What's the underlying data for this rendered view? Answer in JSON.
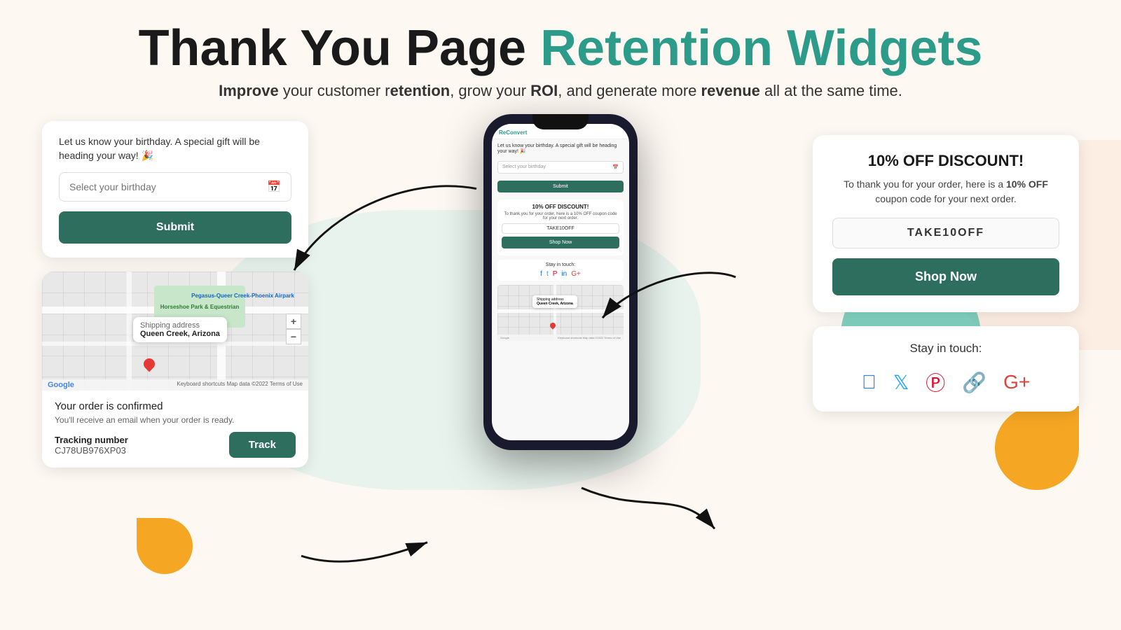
{
  "page": {
    "background": "#fdf8f2"
  },
  "header": {
    "title_black": "Thank You Page",
    "title_teal": "Retention Widgets",
    "subtitle_pre": "Improve",
    "subtitle_mid1": " your customer r",
    "subtitle_mid2": "etention",
    "subtitle_mid3": ", grow your ",
    "subtitle_roi": "ROI",
    "subtitle_mid4": ", and generate more ",
    "subtitle_revenue": "revenue",
    "subtitle_end": " all at the same time."
  },
  "birthday_widget": {
    "text": "Let us know your birthday. A special gift will be heading your way! 🎉",
    "input_placeholder": "Select your birthday",
    "submit_label": "Submit"
  },
  "map_widget": {
    "tooltip_label": "Shipping address",
    "tooltip_city": "Queen Creek, Arizona",
    "park_label": "Horseshoe Park & Equestrian",
    "airport_label": "Pegasus-Queer Creek-Phoenix Airpark",
    "order_confirmed": "Your order is confirmed",
    "order_email": "You'll receive an email when your order is ready.",
    "tracking_label": "Tracking number",
    "tracking_number": "CJ78UB976XP03",
    "track_btn": "Track",
    "zoom_plus": "+",
    "zoom_minus": "−",
    "google_label": "Google",
    "map_footer": "Keyboard shortcuts  Map data ©2022  Terms of Use"
  },
  "discount_widget": {
    "title": "10% OFF DISCOUNT!",
    "desc_pre": "To thank you for your order, here is a ",
    "desc_highlight": "10% OFF",
    "desc_post": " coupon code for your next order.",
    "coupon_code": "TAKE10OFF",
    "shop_now_label": "Shop Now"
  },
  "social_widget": {
    "title": "Stay in touch:",
    "icons": [
      "facebook",
      "twitter",
      "pinterest",
      "linkedin",
      "google-plus"
    ]
  },
  "phone": {
    "brand": "ReConvert",
    "birthday_text": "Let us know your birthday. A special gift will be heading your way! 🎉",
    "input_placeholder": "Select your birthday",
    "submit": "Submit",
    "discount_title": "10% OFF DISCOUNT!",
    "discount_desc": "To thank you for your order, here is a 10% OFF coupon code for your next order.",
    "coupon": "TAKE10OFF",
    "shop_btn": "Shop Now",
    "social_title": "Stay in touch:",
    "map_tooltip_label": "Shipping address",
    "map_tooltip_city": "Queen Creek, Arizona"
  }
}
